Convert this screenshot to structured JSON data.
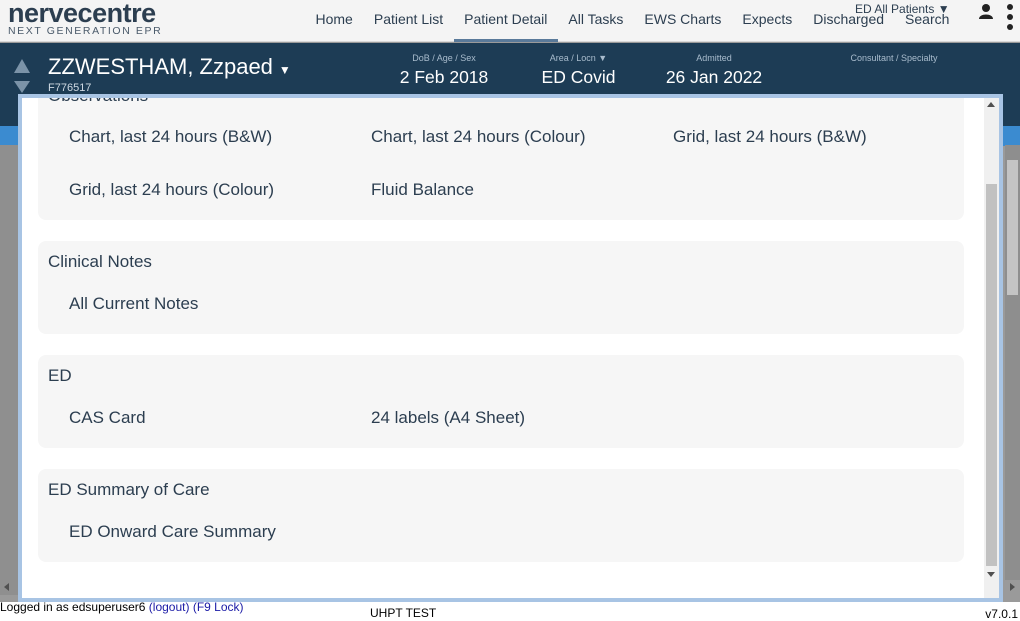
{
  "app": {
    "logo_main": "nervecentre",
    "logo_sub": "NEXT GENERATION EPR"
  },
  "nav": {
    "items": [
      "Home",
      "Patient List",
      "Patient Detail",
      "All Tasks",
      "EWS Charts",
      "Expects",
      "Discharged",
      "Search"
    ],
    "active": "Patient Detail",
    "list_selector": "ED All Patients ▼"
  },
  "patient": {
    "name": "ZZWESTHAM, Zzpaed",
    "caret": "▼",
    "number": "F776517",
    "dob_label": "DoB / Age / Sex",
    "dob_value": "2 Feb 2018",
    "area_label": "Area / Locn  ▼",
    "area_value": "ED Covid",
    "admitted_label": "Admitted",
    "admitted_value": "26 Jan 2022",
    "consultant_label": "Consultant / Specialty",
    "consultant_value": ""
  },
  "modal": {
    "sections": [
      {
        "title": "Observations",
        "items": [
          "Chart, last 24 hours (B&W)",
          "Chart, last 24 hours (Colour)",
          "Grid, last 24 hours (B&W)",
          "Grid, last 24 hours (Colour)",
          "Fluid Balance"
        ]
      },
      {
        "title": "Clinical Notes",
        "items": [
          "All Current Notes"
        ]
      },
      {
        "title": "ED",
        "items": [
          "CAS Card",
          "24 labels (A4 Sheet)"
        ]
      },
      {
        "title": "ED Summary of Care",
        "items": [
          "ED Onward Care Summary"
        ]
      }
    ]
  },
  "footer": {
    "logged_in": "Logged in as edsuperuser6",
    "logout": "(logout)",
    "lock": "(F9 Lock)",
    "environment": "UHPT TEST",
    "version": "v7.0.1"
  },
  "colors": {
    "banner": "#1d3c55",
    "modal_border": "#a8c4e4",
    "section_bg": "#f6f6f6",
    "text": "#2c3e50"
  },
  "icons": [
    "user-icon",
    "kebab-menu-icon",
    "arrow-up-icon",
    "arrow-down-icon",
    "dropdown-caret-icon"
  ]
}
